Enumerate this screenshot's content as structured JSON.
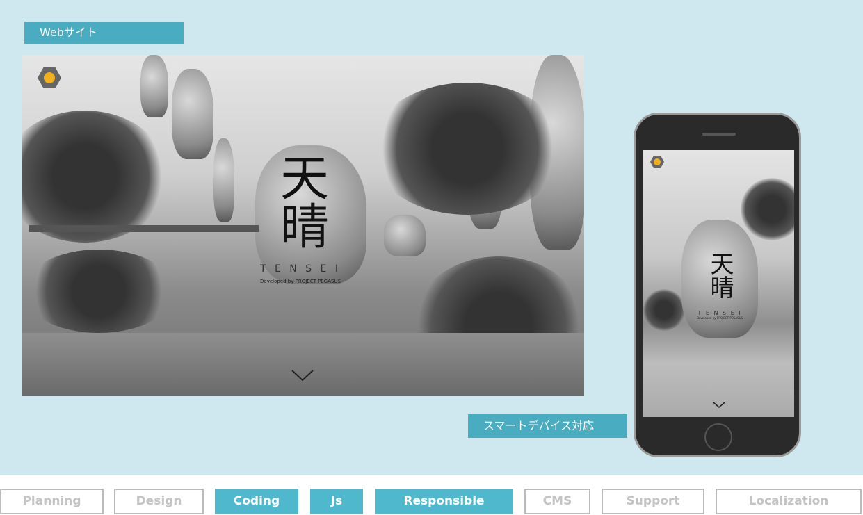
{
  "labels": {
    "website": "Webサイト",
    "smart_device": "スマートデバイス対応"
  },
  "site": {
    "logo_text": "天晴",
    "logo_romaji": "T E N S E I",
    "developer": "Developed by PROJECT PEGASUS",
    "scroll_icon": "chevron-down-icon"
  },
  "tags": [
    {
      "label": "Planning",
      "active": false
    },
    {
      "label": "Design",
      "active": false
    },
    {
      "label": "Coding",
      "active": true
    },
    {
      "label": "Js",
      "active": true
    },
    {
      "label": "Responsible",
      "active": true
    },
    {
      "label": "CMS",
      "active": false
    },
    {
      "label": "Support",
      "active": false
    },
    {
      "label": "Localization",
      "active": false
    }
  ],
  "colors": {
    "accent": "#4fb8cc",
    "background": "#cfe7ee"
  }
}
